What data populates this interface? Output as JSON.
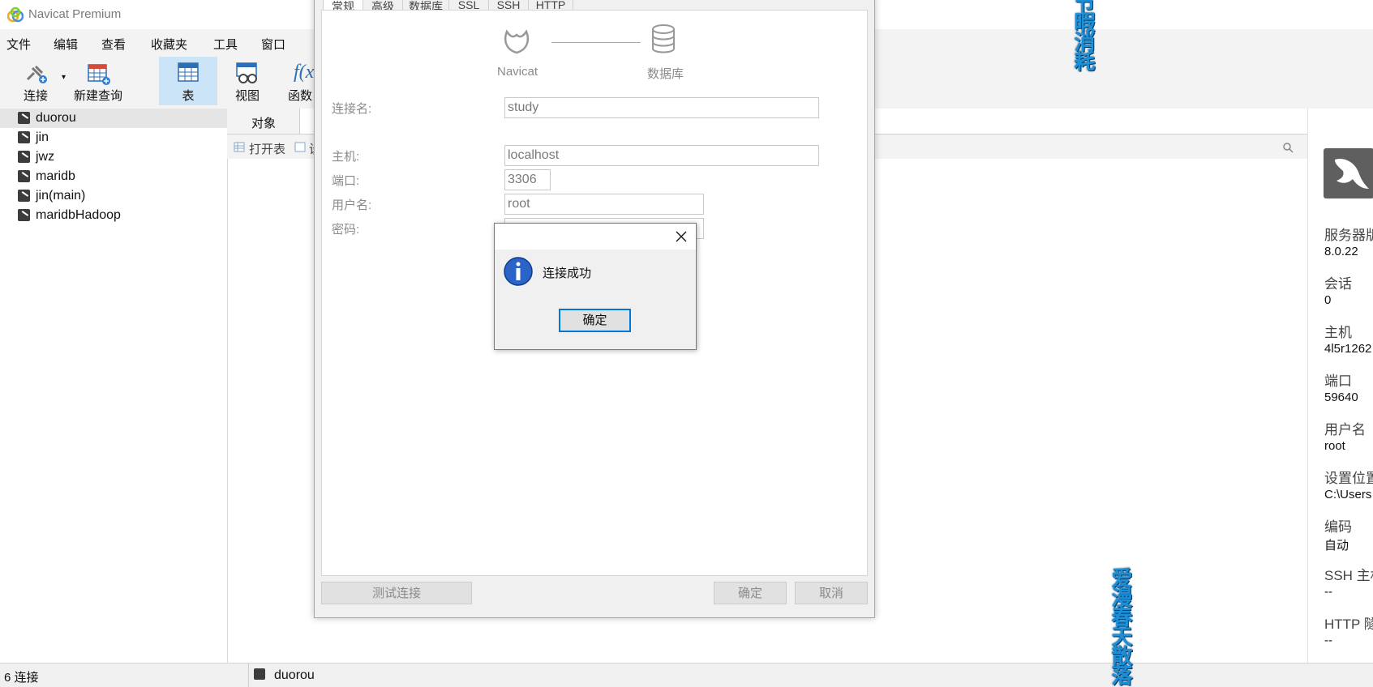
{
  "window": {
    "title": "Navicat Premium"
  },
  "menu": [
    "文件",
    "编辑",
    "查看",
    "收藏夹",
    "工具",
    "窗口"
  ],
  "toolbar": {
    "connect_label": "连接",
    "new_query_label": "新建查询",
    "table_label": "表",
    "view_label": "视图",
    "function_label": "函数"
  },
  "connections": [
    "duorou",
    "jin",
    "jwz",
    "maridb",
    "jin(main)",
    "maridbHadoop"
  ],
  "object_tab": "对象",
  "object_toolbar": {
    "open_table": "打开表",
    "design_partial": "设"
  },
  "info_panel": {
    "items": [
      {
        "label": "服务器版",
        "value": "8.0.22"
      },
      {
        "label": "会话",
        "value": "0"
      },
      {
        "label": "主机",
        "value": "4l5r1262"
      },
      {
        "label": "端口",
        "value": "59640"
      },
      {
        "label": "用户名",
        "value": "root"
      },
      {
        "label": "设置位置",
        "value": "C:\\Users"
      },
      {
        "label": "编码",
        "value": "自动"
      },
      {
        "label": "SSH 主机",
        "value": "--"
      },
      {
        "label": "HTTP 隧",
        "value": "--"
      }
    ]
  },
  "status": {
    "connections_count": "6 连接",
    "current": "duorou"
  },
  "dialog": {
    "tabs": [
      "常规",
      "高级",
      "数据库",
      "SSL",
      "SSH",
      "HTTP"
    ],
    "diagram": {
      "left": "Navicat",
      "right": "数据库"
    },
    "fields": {
      "conn_name": {
        "label": "连接名:",
        "value": "study"
      },
      "host": {
        "label": "主机:",
        "value": "localhost"
      },
      "port": {
        "label": "端口:",
        "value": "3306"
      },
      "user": {
        "label": "用户名:",
        "value": "root"
      },
      "password": {
        "label": "密码:",
        "value": ""
      }
    },
    "buttons": {
      "test": "测试连接",
      "ok": "确定",
      "cancel": "取消"
    }
  },
  "message": {
    "text": "连接成功",
    "ok": "确定"
  },
  "overlay": {
    "top_right_text": "节暇消耗",
    "bottom_text": "爱漫春天散落"
  }
}
